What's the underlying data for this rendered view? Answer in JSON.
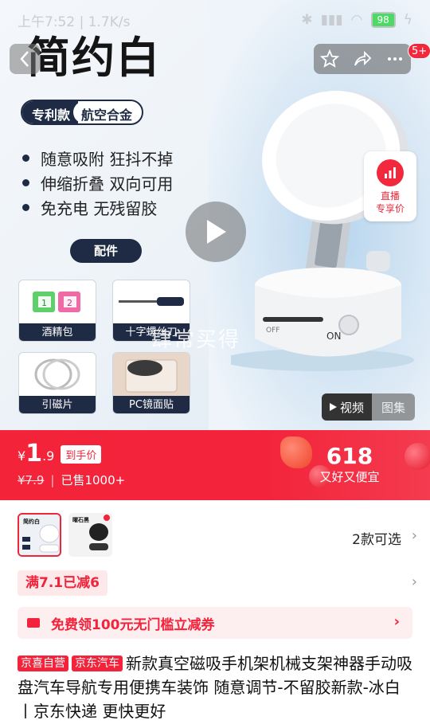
{
  "status_bar": {
    "time": "上午7:52 | 1.7K/s",
    "battery": "98"
  },
  "hero": {
    "title": "简约白",
    "tag_left": "专利款",
    "tag_right": "航空合金",
    "features": [
      "随意吸附 狂抖不掉",
      "伸缩折叠 双向可用",
      "免充电 无残留胶"
    ],
    "accessory_title": "配件",
    "accessories": [
      "酒精包",
      "十字螺丝刀",
      "引磁片",
      "PC镜面贴"
    ],
    "watermark": "肆常买得",
    "device_labels": [
      "ON",
      "OFF"
    ],
    "live": {
      "line1": "直播",
      "line2": "专享价"
    },
    "media_tabs": {
      "video": "视频",
      "gallery": "图集"
    },
    "cart_badge": "5+",
    "pad_labels": [
      "1",
      "2"
    ]
  },
  "price": {
    "currency": "¥",
    "integer": "1",
    "decimal": ".9",
    "tag": "到手价",
    "original": "¥7.9",
    "sold": "已售1000+",
    "promo_number": "618",
    "promo_text": "又好又便宜"
  },
  "variants": {
    "count_text": "2款可选",
    "thumb_labels": [
      "简约白",
      "曜石黑"
    ]
  },
  "discount": {
    "text": "满7.1已减6"
  },
  "coupon": {
    "text": "免费领100元无门槛立减券"
  },
  "product": {
    "badge_self": "京喜自营",
    "badge_car": "京东汽车",
    "title": "新款真空磁吸手机架机械支架神器手动吸盘汽车导航专用便携车装饰 随意调节-不留胶新款-冰白丨京东快递 更快更好"
  },
  "colors": {
    "accent": "#f2233a",
    "navy": "#1f2b44"
  },
  "icons": [
    "back-icon",
    "star-icon",
    "share-icon",
    "more-icon",
    "play-icon",
    "live-chart-icon",
    "coupon-icon",
    "chevron-right-icon"
  ]
}
